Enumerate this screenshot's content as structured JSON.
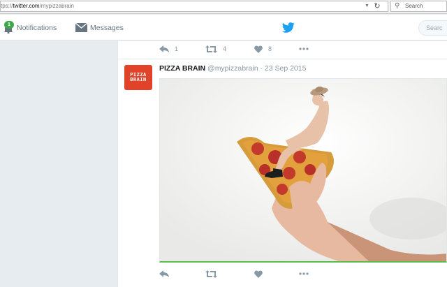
{
  "browser": {
    "url_prefix": "tps://",
    "url_domain": "twitter.com",
    "url_path": "/mypizzabrain",
    "search_placeholder": "Search"
  },
  "nav": {
    "notifications_label": "Notifications",
    "notifications_badge": "1",
    "messages_label": "Messages",
    "search_placeholder": "Searc"
  },
  "previous_tweet": {
    "reply_count": "1",
    "retweet_count": "4",
    "like_count": "8"
  },
  "tweet": {
    "avatar_text_line1": "PIZZA",
    "avatar_text_line2": "BRAIN",
    "name": "PIZZA BRAIN",
    "handle": "@mypizzabrain",
    "date": "23 Sep 2015",
    "media_icon": "photo-pizza-with-person"
  },
  "colors": {
    "twitter_blue": "#1da1f2",
    "badge_green": "#3fa84a",
    "avatar_red": "#e0432a"
  }
}
